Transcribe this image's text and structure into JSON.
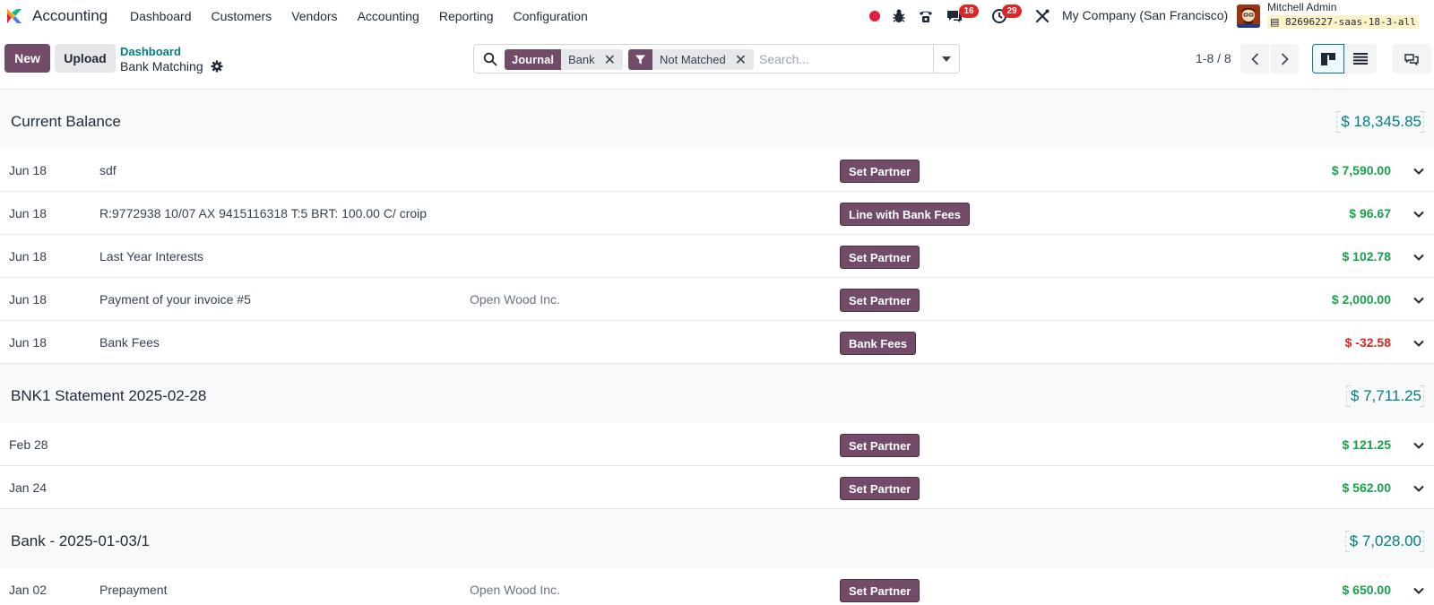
{
  "navbar": {
    "app_name": "Accounting",
    "menu": [
      "Dashboard",
      "Customers",
      "Vendors",
      "Accounting",
      "Reporting",
      "Configuration"
    ],
    "messages_count": "16",
    "activities_count": "29",
    "company": "My Company (San Francisco)",
    "user_name": "Mitchell Admin",
    "database": "82696227-saas-18-3-all"
  },
  "control_panel": {
    "new_label": "New",
    "upload_label": "Upload",
    "breadcrumb_parent": "Dashboard",
    "breadcrumb_current": "Bank Matching",
    "search": {
      "facets": [
        {
          "label": "Journal",
          "value": "Bank"
        },
        {
          "icon": "filter-icon",
          "value": "Not Matched"
        }
      ],
      "placeholder": "Search..."
    },
    "pager": "1-8 / 8",
    "active_view": "kanban"
  },
  "colors": {
    "brand": "#714b67",
    "teal": "#017e84",
    "positive": "#16a34a",
    "negative": "#dc2626"
  },
  "groups": [
    {
      "title": "Current Balance",
      "amount": "$ 18,345.85",
      "rows": [
        {
          "date": "Jun 18",
          "label": "sdf",
          "partner": "",
          "action": "Set Partner",
          "amount": "$ 7,590.00",
          "negative": false
        },
        {
          "date": "Jun 18",
          "label": "R:9772938 10/07 AX 9415116318 T:5 BRT: 100.00 C/ croip",
          "partner": "",
          "action": "Line with Bank Fees",
          "amount": "$ 96.67",
          "negative": false
        },
        {
          "date": "Jun 18",
          "label": "Last Year Interests",
          "partner": "",
          "action": "Set Partner",
          "amount": "$ 102.78",
          "negative": false
        },
        {
          "date": "Jun 18",
          "label": "Payment of your invoice #5",
          "partner": "Open Wood Inc.",
          "action": "Set Partner",
          "amount": "$ 2,000.00",
          "negative": false
        },
        {
          "date": "Jun 18",
          "label": "Bank Fees",
          "partner": "",
          "action": "Bank Fees",
          "amount": "$ -32.58",
          "negative": true
        }
      ]
    },
    {
      "title": "BNK1 Statement 2025-02-28",
      "amount": "$ 7,711.25",
      "rows": [
        {
          "date": "Feb 28",
          "label": "",
          "partner": "",
          "action": "Set Partner",
          "amount": "$ 121.25",
          "negative": false
        },
        {
          "date": "Jan 24",
          "label": "",
          "partner": "",
          "action": "Set Partner",
          "amount": "$ 562.00",
          "negative": false
        }
      ]
    },
    {
      "title": "Bank - 2025-01-03/1",
      "amount": "$ 7,028.00",
      "rows": [
        {
          "date": "Jan 02",
          "label": "Prepayment",
          "partner": "Open Wood Inc.",
          "action": "Set Partner",
          "amount": "$ 650.00",
          "negative": false
        }
      ]
    }
  ]
}
